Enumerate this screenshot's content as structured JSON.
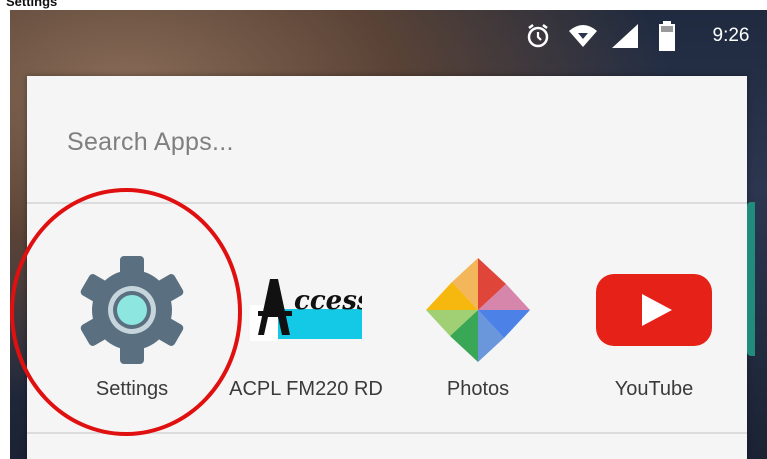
{
  "page_title": "Settings",
  "status_bar": {
    "time": "9:26",
    "icons": [
      "alarm-icon",
      "wifi-icon",
      "signal-icon",
      "battery-icon"
    ]
  },
  "search": {
    "placeholder": "Search Apps..."
  },
  "apps": [
    {
      "label": "Settings",
      "icon": "settings-gear-icon"
    },
    {
      "label": "ACPL FM220 RD",
      "icon": "access-logo-icon"
    },
    {
      "label": "Photos",
      "icon": "photos-pinwheel-icon"
    },
    {
      "label": "YouTube",
      "icon": "youtube-icon"
    }
  ],
  "colors": {
    "highlight": "#e01010",
    "accent": "#1f8c7c",
    "drawer_bg": "#f5f5f5"
  }
}
